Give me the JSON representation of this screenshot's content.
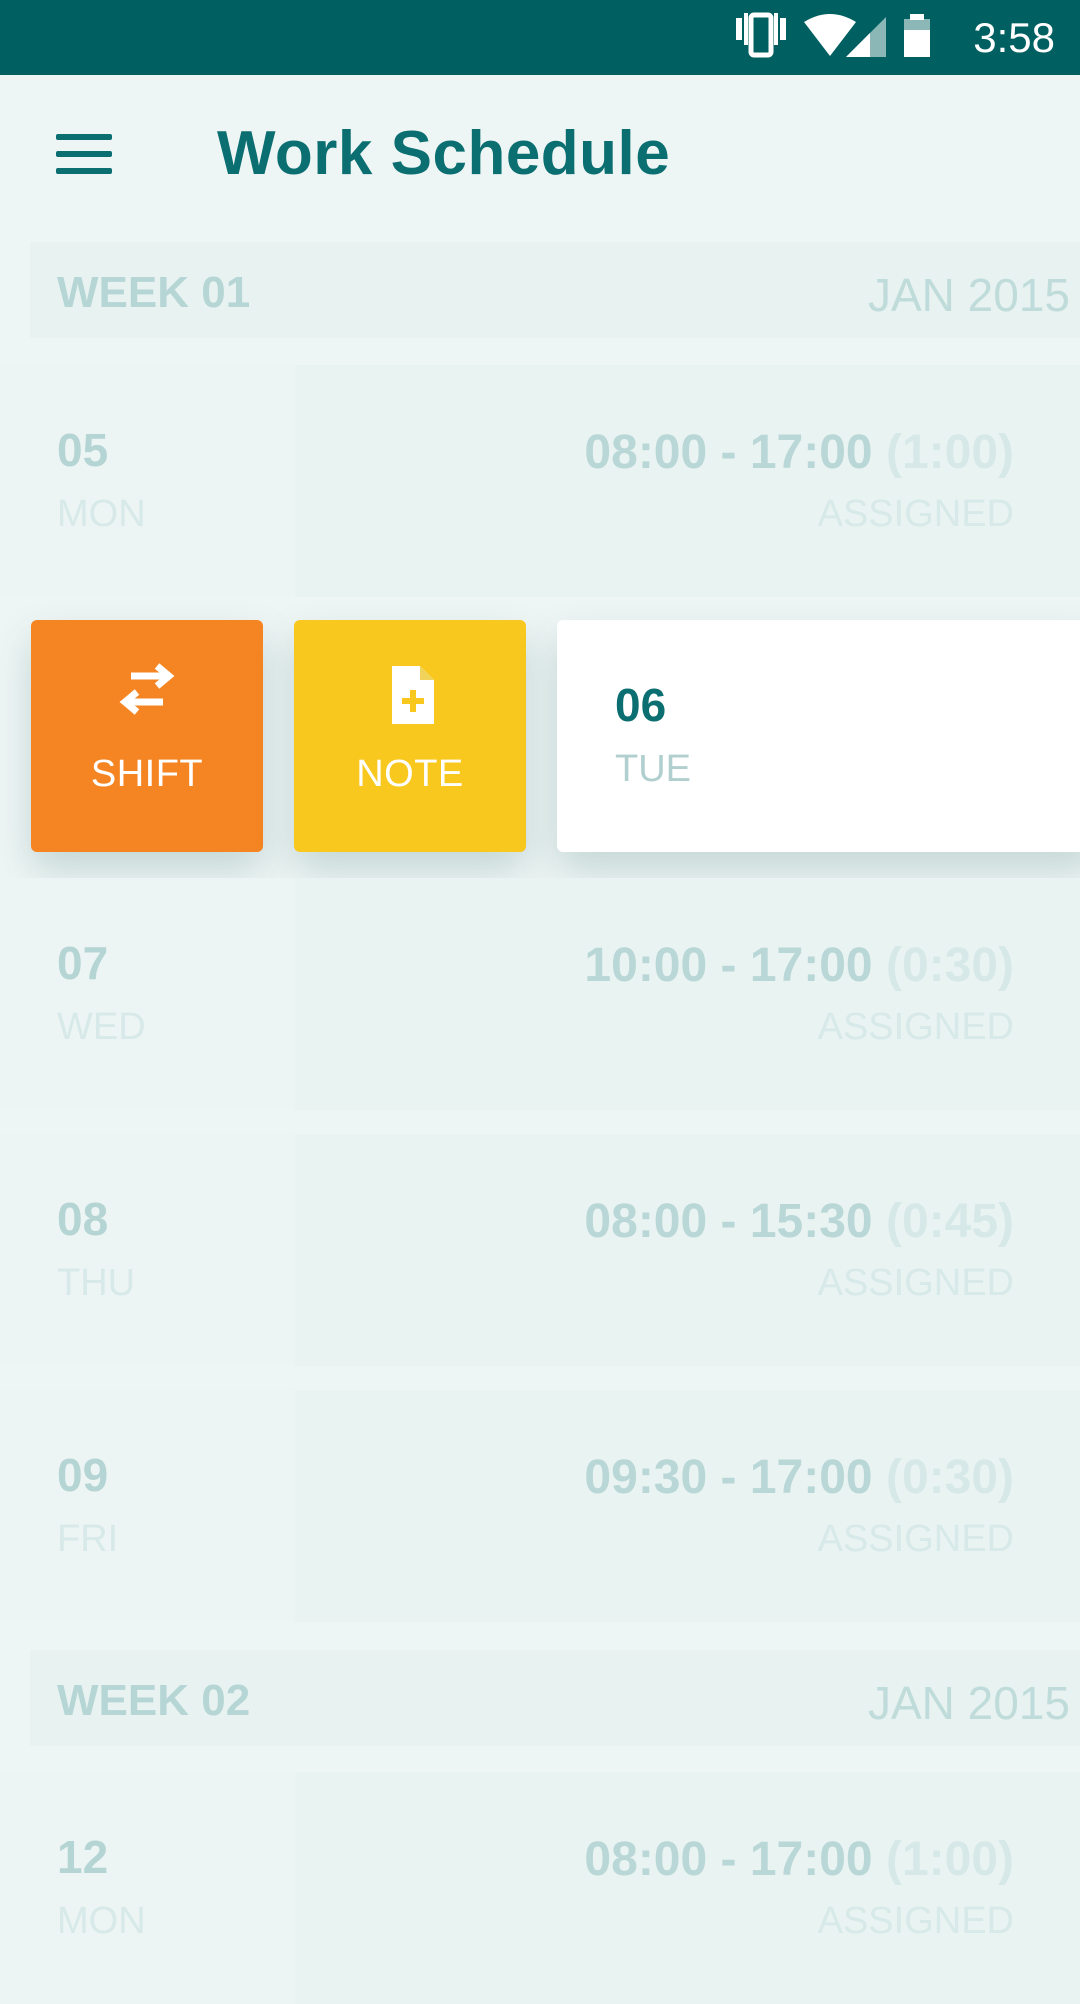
{
  "status_bar": {
    "time": "3:58",
    "icons": [
      "vibrate-icon",
      "wifi-icon",
      "cell-signal-icon",
      "battery-icon"
    ]
  },
  "app_bar": {
    "menu_icon": "menu-icon",
    "title": "Work Schedule"
  },
  "colors": {
    "status_bar": "#005f61",
    "accent": "#0b6e70",
    "shift": "#f58523",
    "note": "#f8c81e",
    "background": "#eef6f5"
  },
  "weeks": [
    {
      "label": "WEEK 01",
      "month": "JAN 2015"
    },
    {
      "label": "WEEK 02",
      "month": "JAN 2015"
    }
  ],
  "days": [
    {
      "num": "05",
      "name": "MON",
      "time": "08:00 - 17:00",
      "break": "(1:00)",
      "status": "ASSIGNED"
    },
    {
      "num": "06",
      "name": "TUE"
    },
    {
      "num": "07",
      "name": "WED",
      "time": "10:00 - 17:00",
      "break": "(0:30)",
      "status": "ASSIGNED"
    },
    {
      "num": "08",
      "name": "THU",
      "time": "08:00 - 15:30",
      "break": "(0:45)",
      "status": "ASSIGNED"
    },
    {
      "num": "09",
      "name": "FRI",
      "time": "09:30 - 17:00",
      "break": "(0:30)",
      "status": "ASSIGNED"
    },
    {
      "num": "12",
      "name": "MON",
      "time": "08:00 - 17:00",
      "break": "(1:00)",
      "status": "ASSIGNED"
    }
  ],
  "actions": {
    "shift": {
      "label": "SHIFT",
      "icon": "swap-arrows-icon"
    },
    "note": {
      "label": "NOTE",
      "icon": "add-note-icon"
    }
  }
}
